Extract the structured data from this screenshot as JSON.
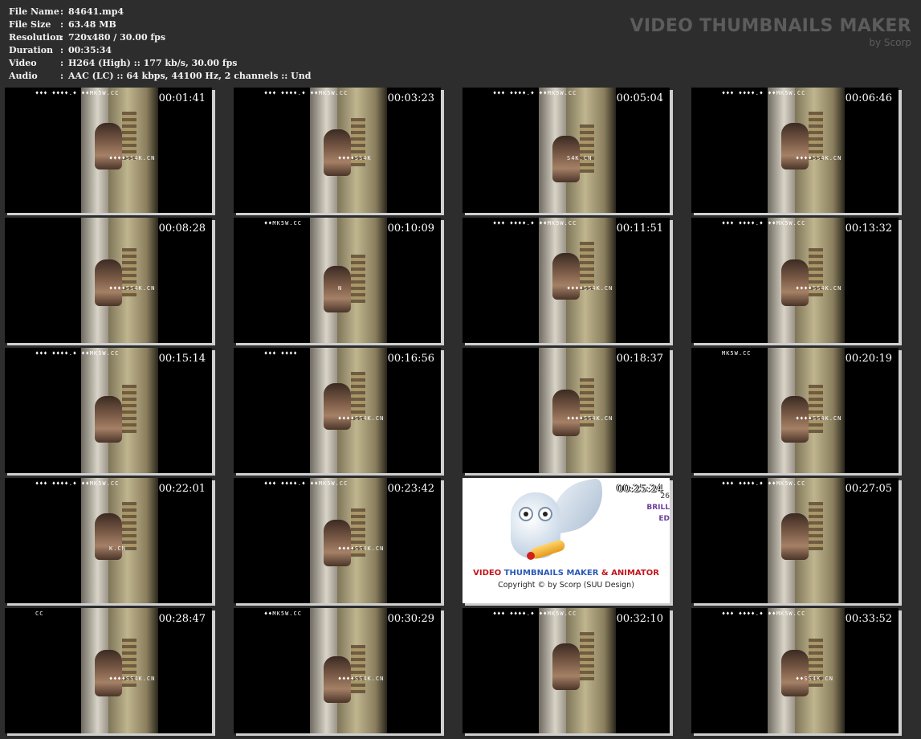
{
  "info": {
    "rows": [
      {
        "label": "File Name",
        "value": "84641.mp4"
      },
      {
        "label": "File Size",
        "value": "63.48 MB"
      },
      {
        "label": "Resolution",
        "value": "720x480 / 30.00 fps"
      },
      {
        "label": "Duration",
        "value": "00:35:34"
      },
      {
        "label": "Video",
        "value": "H264 (High) :: 177 kb/s, 30.00 fps"
      },
      {
        "label": "Audio",
        "value": "AAC (LC) :: 64 kbps, 44100 Hz, 2 channels :: Und"
      }
    ],
    "separator": ":"
  },
  "brand": {
    "title": "VIDEO THUMBNAILS MAKER",
    "by": "by Scorp"
  },
  "thumbnails": [
    {
      "time": "00:01:41",
      "wm_top": "♦♦♦ ♦♦♦♦.♦ ♦♦MK5W.CC",
      "wm_mid": "♦♦♦♦SS4K.CN"
    },
    {
      "time": "00:03:23",
      "wm_top": "♦♦♦ ♦♦♦♦.♦ ♦♦MK5W.CC",
      "wm_mid": "♦♦♦♦SS4K"
    },
    {
      "time": "00:05:04",
      "wm_top": "♦♦♦ ♦♦♦♦.♦ ♦♦MK5W.CC",
      "wm_mid": "S4K.CN"
    },
    {
      "time": "00:06:46",
      "wm_top": "♦♦♦ ♦♦♦♦.♦ ♦♦MK5W.CC",
      "wm_mid": "♦♦♦♦SS4K.CN"
    },
    {
      "time": "00:08:28",
      "wm_top": "",
      "wm_mid": "♦♦♦♦SS4K.CN"
    },
    {
      "time": "00:10:09",
      "wm_top": "♦♦MK5W.CC",
      "wm_mid": "N"
    },
    {
      "time": "00:11:51",
      "wm_top": "♦♦♦ ♦♦♦♦.♦ ♦♦MK5W.CC",
      "wm_mid": "♦♦♦♦SS4K.CN"
    },
    {
      "time": "00:13:32",
      "wm_top": "♦♦♦ ♦♦♦♦.♦ ♦♦MK5W.CC",
      "wm_mid": "♦♦♦♦SS4K.CN"
    },
    {
      "time": "00:15:14",
      "wm_top": "♦♦♦ ♦♦♦♦.♦ ♦♦MK5W.CC",
      "wm_mid": ""
    },
    {
      "time": "00:16:56",
      "wm_top": "♦♦♦ ♦♦♦♦",
      "wm_mid": "♦♦♦♦SS4K.CN"
    },
    {
      "time": "00:18:37",
      "wm_top": "",
      "wm_mid": "♦♦♦♦SS4K.CN"
    },
    {
      "time": "00:20:19",
      "wm_top": "MK5W.CC",
      "wm_mid": "♦♦♦♦SS4K.CN"
    },
    {
      "time": "00:22:01",
      "wm_top": "♦♦♦ ♦♦♦♦.♦ ♦♦MK5W.CC",
      "wm_mid": "K.CN"
    },
    {
      "time": "00:23:42",
      "wm_top": "♦♦♦ ♦♦♦♦.♦ ♦♦MK5W.CC",
      "wm_mid": "♦♦♦♦SS4K.CN"
    },
    {
      "time": "00:25:24",
      "logo": true
    },
    {
      "time": "00:27:05",
      "wm_top": "♦♦♦ ♦♦♦♦.♦ ♦♦MK5W.CC",
      "wm_mid": ""
    },
    {
      "time": "00:28:47",
      "wm_top": "CC",
      "wm_mid": "♦♦♦♦SS4K.CN"
    },
    {
      "time": "00:30:29",
      "wm_top": "♦♦MK5W.CC",
      "wm_mid": "♦♦♦♦SS4K.CN"
    },
    {
      "time": "00:32:10",
      "wm_top": "♦♦♦ ♦♦♦♦.♦ ♦♦MK5W.CC",
      "wm_mid": ""
    },
    {
      "time": "00:33:52",
      "wm_top": "♦♦♦ ♦♦♦♦.♦ ♦♦MK5W.CC",
      "wm_mid": "♦♦SS4K.CN"
    }
  ],
  "logo": {
    "title_a": "VIDEO ",
    "title_b": "THUMBNAILS MAKER",
    "title_c": " & ",
    "title_d": "ANIMATOR",
    "copyright": "Copyright © by Scorp (SUU Design)",
    "side_1": "26",
    "side_2": "BRILL",
    "side_3": "ED"
  }
}
